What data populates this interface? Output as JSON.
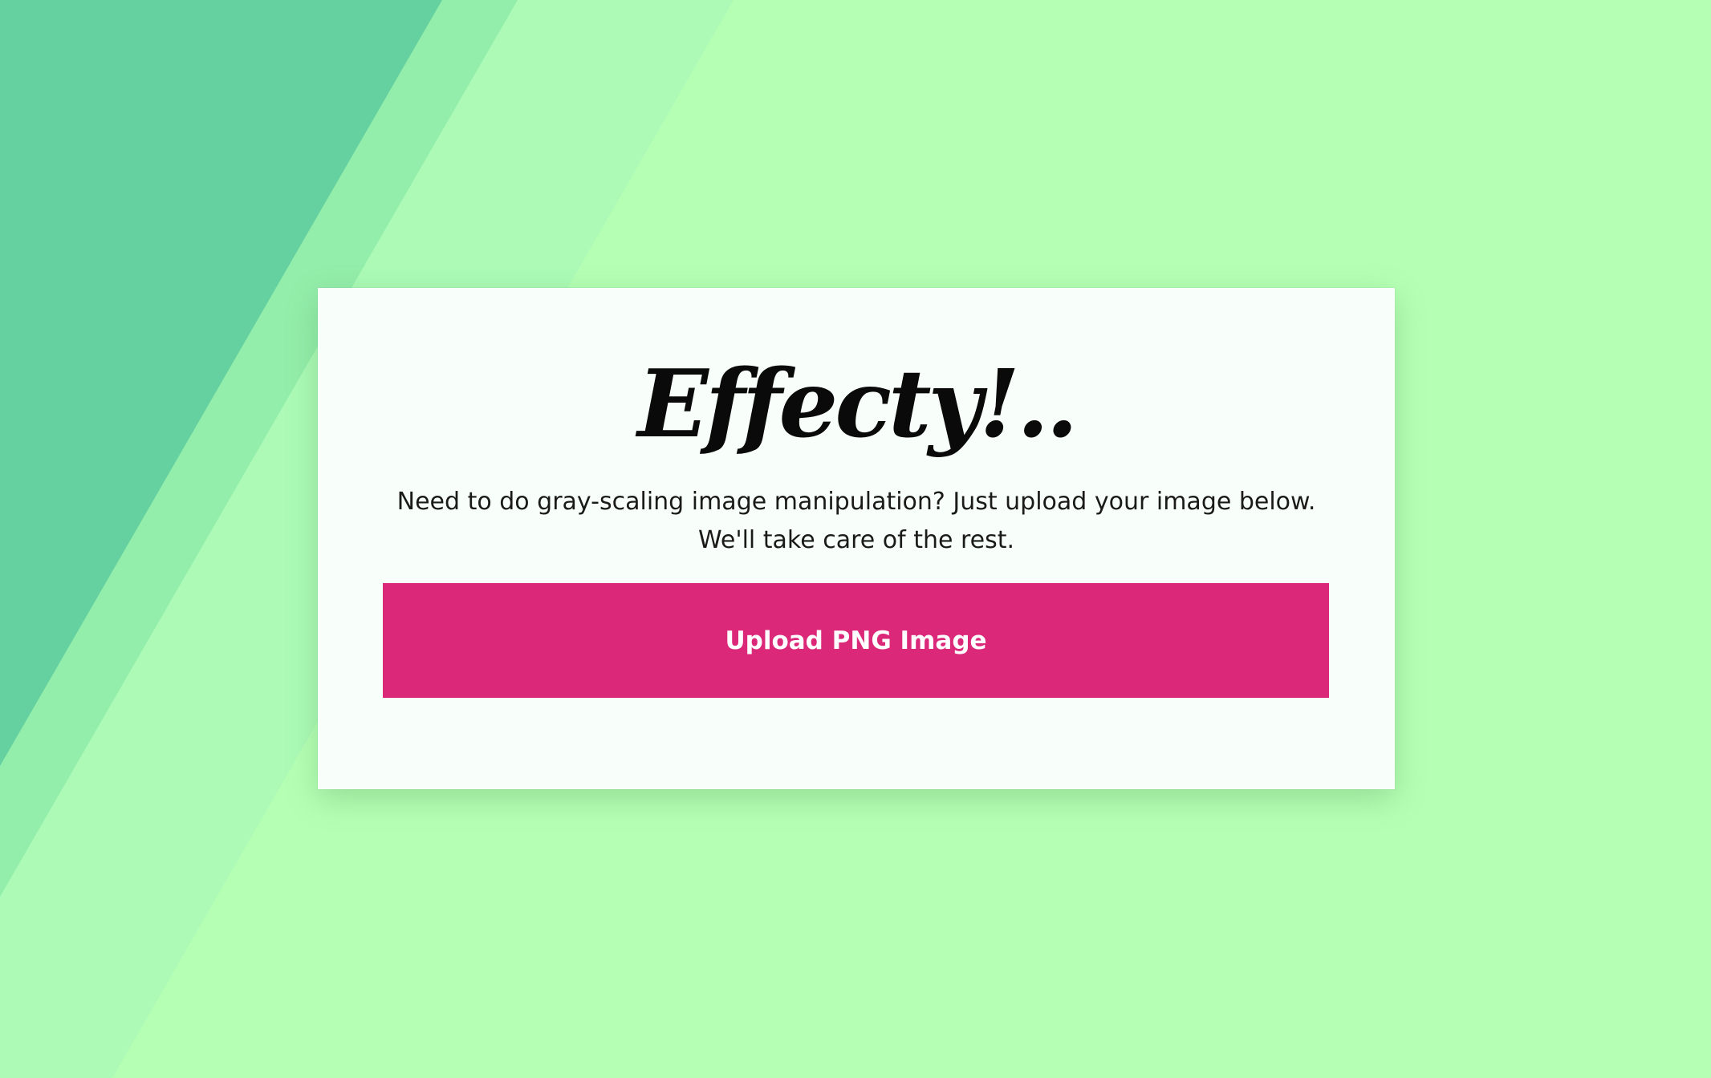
{
  "app": {
    "logo_text": "Effecty!..",
    "description": "Need to do gray-scaling image manipulation? Just upload your image below. We'll take care of the rest.",
    "upload_button_label": "Upload PNG Image"
  },
  "colors": {
    "background": "#b5ffb5",
    "stripe_dark": "#66d1a0",
    "stripe_mid": "#94eeab",
    "stripe_light": "#acfab6",
    "card_background": "#f8fffa",
    "button_accent": "#db2879",
    "button_text": "#ffffff",
    "text": "#1a1a1a"
  }
}
